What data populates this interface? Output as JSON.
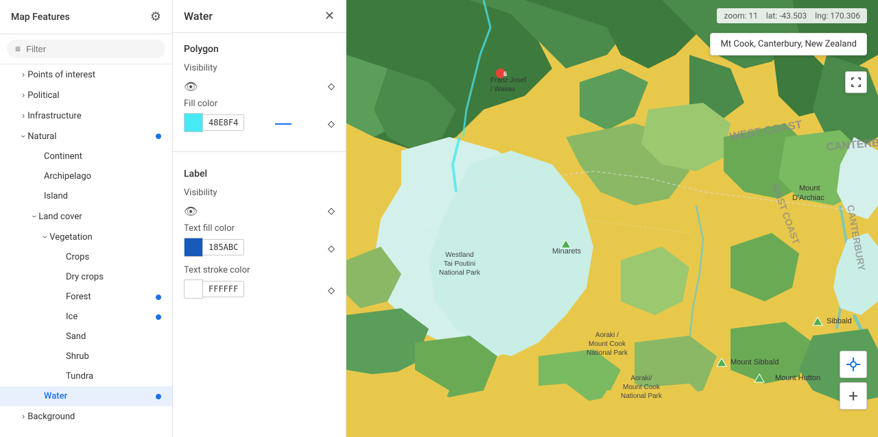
{
  "sidebar": {
    "title": "Map Features",
    "filter_placeholder": "Filter",
    "items": [
      {
        "id": "points-of-interest",
        "label": "Points of interest",
        "indent": 0,
        "chevron": "›",
        "dot": false
      },
      {
        "id": "political",
        "label": "Political",
        "indent": 0,
        "chevron": "›",
        "dot": false
      },
      {
        "id": "infrastructure",
        "label": "Infrastructure",
        "indent": 0,
        "chevron": "›",
        "dot": false
      },
      {
        "id": "natural",
        "label": "Natural",
        "indent": 0,
        "chevron": "›",
        "dot": true,
        "expanded": true
      },
      {
        "id": "continent",
        "label": "Continent",
        "indent": 1,
        "chevron": "",
        "dot": false
      },
      {
        "id": "archipelago",
        "label": "Archipelago",
        "indent": 1,
        "chevron": "",
        "dot": false
      },
      {
        "id": "island",
        "label": "Island",
        "indent": 1,
        "chevron": "",
        "dot": false
      },
      {
        "id": "land-cover",
        "label": "Land cover",
        "indent": 1,
        "chevron": "›",
        "dot": false,
        "expanded": true
      },
      {
        "id": "vegetation",
        "label": "Vegetation",
        "indent": 2,
        "chevron": "›",
        "dot": false,
        "expanded": true
      },
      {
        "id": "crops",
        "label": "Crops",
        "indent": 3,
        "chevron": "",
        "dot": false
      },
      {
        "id": "dry-crops",
        "label": "Dry crops",
        "indent": 3,
        "chevron": "",
        "dot": false
      },
      {
        "id": "forest",
        "label": "Forest",
        "indent": 3,
        "chevron": "",
        "dot": true
      },
      {
        "id": "ice",
        "label": "Ice",
        "indent": 3,
        "chevron": "",
        "dot": true
      },
      {
        "id": "sand",
        "label": "Sand",
        "indent": 3,
        "chevron": "",
        "dot": false
      },
      {
        "id": "shrub",
        "label": "Shrub",
        "indent": 3,
        "chevron": "",
        "dot": false
      },
      {
        "id": "tundra",
        "label": "Tundra",
        "indent": 3,
        "chevron": "",
        "dot": false
      },
      {
        "id": "water",
        "label": "Water",
        "indent": 1,
        "chevron": "",
        "dot": true,
        "selected": true
      },
      {
        "id": "background",
        "label": "Background",
        "indent": 0,
        "chevron": "›",
        "dot": false
      }
    ]
  },
  "panel": {
    "title": "Water",
    "polygon_label": "Polygon",
    "visibility_label": "Visibility",
    "fill_color_label": "Fill color",
    "fill_color_hex": "48E8F4",
    "fill_color_value": "#48e8f4",
    "label_section": "Label",
    "label_visibility_label": "Visibility",
    "text_fill_color_label": "Text fill color",
    "text_fill_color_hex": "185ABC",
    "text_fill_color_value": "#185abc",
    "text_stroke_color_label": "Text stroke color",
    "text_stroke_color_hex": "FFFFFF",
    "text_stroke_color_value": "#ffffff"
  },
  "map": {
    "zoom_label": "zoom:",
    "zoom_value": "11",
    "lat_label": "lat:",
    "lat_value": "-43.503",
    "lng_label": "lng:",
    "lng_value": "170.306",
    "location_tooltip": "Mt Cook, Canterbury, New Zealand",
    "plus_icon": "+",
    "fullscreen_icon": "⛶",
    "locate_icon": "◎"
  },
  "icons": {
    "gear": "⚙",
    "filter": "≡",
    "close": "✕",
    "eye": "👁",
    "diamond": "◇",
    "chevron_right": "›",
    "chevron_down": "∨"
  }
}
